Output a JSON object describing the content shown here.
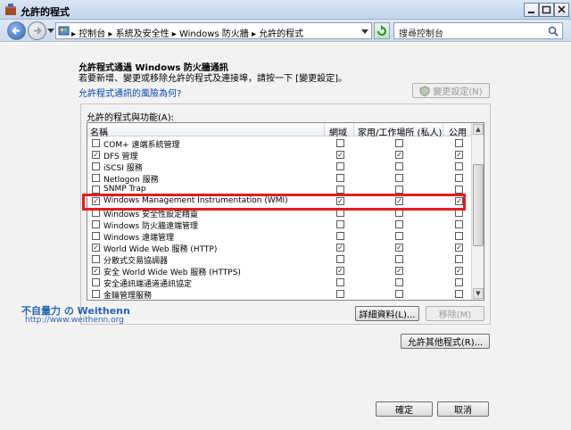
{
  "window": {
    "title": "允許的程式"
  },
  "address": {
    "breadcrumb": "▸ 控制台 ▸ 系統及安全性 ▸ Windows 防火牆 ▸ 允許的程式",
    "search_placeholder": "搜尋控制台"
  },
  "main": {
    "heading": "允許程式通過 Windows 防火牆通訊",
    "subheading": "若要新增、變更或移除允許的程式及連接埠，請按一下 [變更設定]。",
    "risk_link": "允許程式通訊的風險為何?",
    "change_settings_label": "變更設定(N)",
    "group_label": "允許的程式與功能(A):",
    "columns": [
      "名稱",
      "網域",
      "家用/工作場所 (私人)",
      "公用"
    ],
    "rows": [
      {
        "name": "COM+ 遠端系統管理",
        "enabled": false,
        "domain": false,
        "private": false,
        "public": false
      },
      {
        "name": "DFS 管理",
        "enabled": true,
        "domain": true,
        "private": true,
        "public": true
      },
      {
        "name": "iSCSI 服務",
        "enabled": false,
        "domain": false,
        "private": false,
        "public": false
      },
      {
        "name": "Netlogon 服務",
        "enabled": false,
        "domain": false,
        "private": false,
        "public": false
      },
      {
        "name": "SNMP Trap",
        "enabled": false,
        "domain": false,
        "private": false,
        "public": false
      },
      {
        "name": "Windows Management Instrumentation (WMI)",
        "enabled": true,
        "domain": true,
        "private": true,
        "public": true
      },
      {
        "name": "Windows 安全性設定精靈",
        "enabled": false,
        "domain": false,
        "private": false,
        "public": false
      },
      {
        "name": "Windows 防火牆遠端管理",
        "enabled": false,
        "domain": false,
        "private": false,
        "public": false
      },
      {
        "name": "Windows 遠端管理",
        "enabled": false,
        "domain": false,
        "private": false,
        "public": false
      },
      {
        "name": "World Wide Web 服務 (HTTP)",
        "enabled": true,
        "domain": true,
        "private": true,
        "public": true
      },
      {
        "name": "分散式交易協調器",
        "enabled": false,
        "domain": false,
        "private": false,
        "public": false
      },
      {
        "name": "安全 World Wide Web 服務 (HTTPS)",
        "enabled": true,
        "domain": true,
        "private": true,
        "public": true
      },
      {
        "name": "安全通訊端通道通訊協定",
        "enabled": false,
        "domain": false,
        "private": false,
        "public": false
      },
      {
        "name": "金鑰管理服務",
        "enabled": false,
        "domain": false,
        "private": false,
        "public": false
      }
    ],
    "details_label": "詳細資料(L)...",
    "remove_label": "移除(M)",
    "allow_other_label": "允許其他程式(R)..."
  },
  "footer": {
    "ok_label": "確定",
    "cancel_label": "取消"
  },
  "watermark": {
    "line1": "不自量力 の Weithenn",
    "line2": "http://www.weithenn.org"
  },
  "colors": {
    "highlight": "#e21d1d",
    "link": "#0645ad",
    "watermark": "#2a64b8"
  },
  "icons": {
    "app": "firewall-icon",
    "back": "back-arrow-icon",
    "forward": "forward-arrow-icon",
    "refresh": "refresh-icon",
    "search": "search-icon"
  }
}
